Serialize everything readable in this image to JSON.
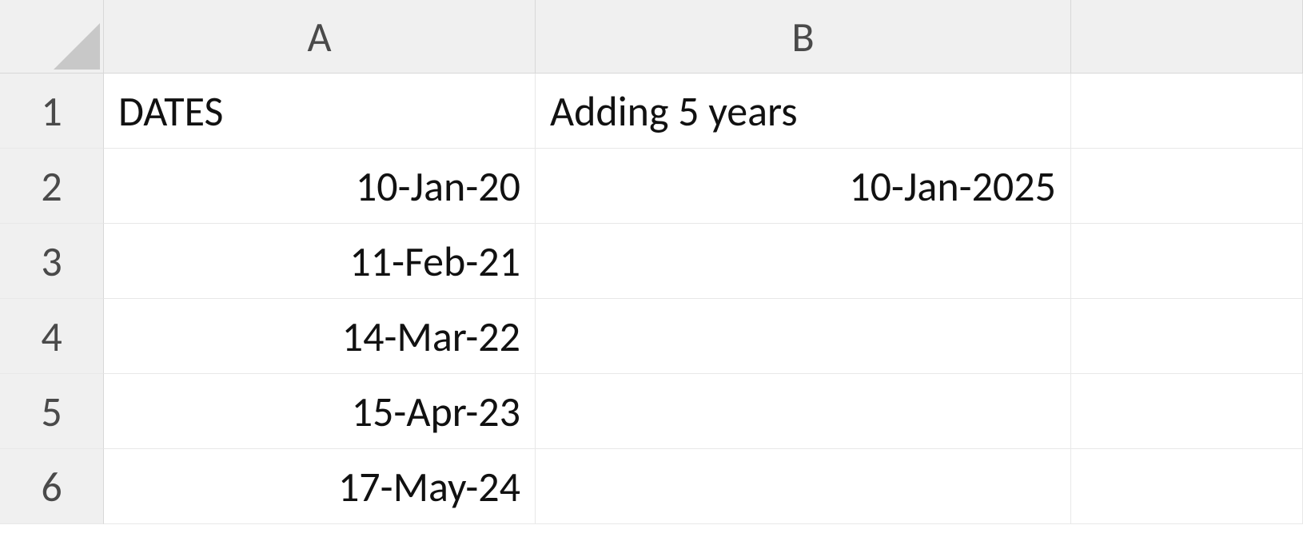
{
  "columns": {
    "A": "A",
    "B": "B"
  },
  "rowNumbers": [
    "1",
    "2",
    "3",
    "4",
    "5",
    "6"
  ],
  "cells": {
    "A1": "DATES",
    "B1": "Adding 5 years",
    "A2": "10-Jan-20",
    "B2": "10-Jan-2025",
    "A3": "11-Feb-21",
    "B3": "",
    "A4": "14-Mar-22",
    "B4": "",
    "A5": "15-Apr-23",
    "B5": "",
    "A6": "17-May-24",
    "B6": ""
  }
}
